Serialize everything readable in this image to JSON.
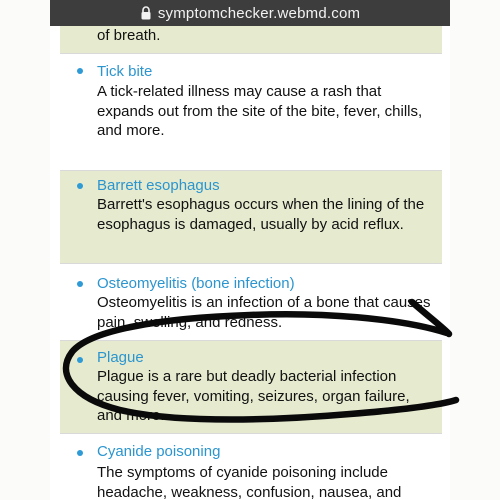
{
  "browser": {
    "url": "symptomchecker.webmd.com"
  },
  "list": {
    "partial_top": "of breath.",
    "items": [
      {
        "title": "Tick bite",
        "description": "A tick-related illness may cause a rash that expands out from the site of the bite, fever, chills, and more."
      },
      {
        "title": "Barrett esophagus",
        "description": "Barrett's esophagus occurs when the lining of the esophagus is damaged, usually by acid reflux."
      },
      {
        "title": "Osteomyelitis (bone infection)",
        "description": "Osteomyelitis is an infection of a bone that causes pain, swelling, and redness."
      },
      {
        "title": "Plague",
        "description": "Plague is a rare but deadly bacterial infection causing fever, vomiting, seizures, organ failure, and more."
      },
      {
        "title": "Cyanide poisoning",
        "description": "The symptoms of cyanide poisoning include headache, weakness, confusion, nausea, and seizures."
      }
    ]
  },
  "colors": {
    "accent": "#2b95cf",
    "row_alt": "#e6ebcf",
    "address_bar": "#3d3d3d",
    "annotation_ink": "#0a0a0a"
  },
  "annotation": {
    "type": "hand-drawn-circle",
    "target": "Plague"
  }
}
